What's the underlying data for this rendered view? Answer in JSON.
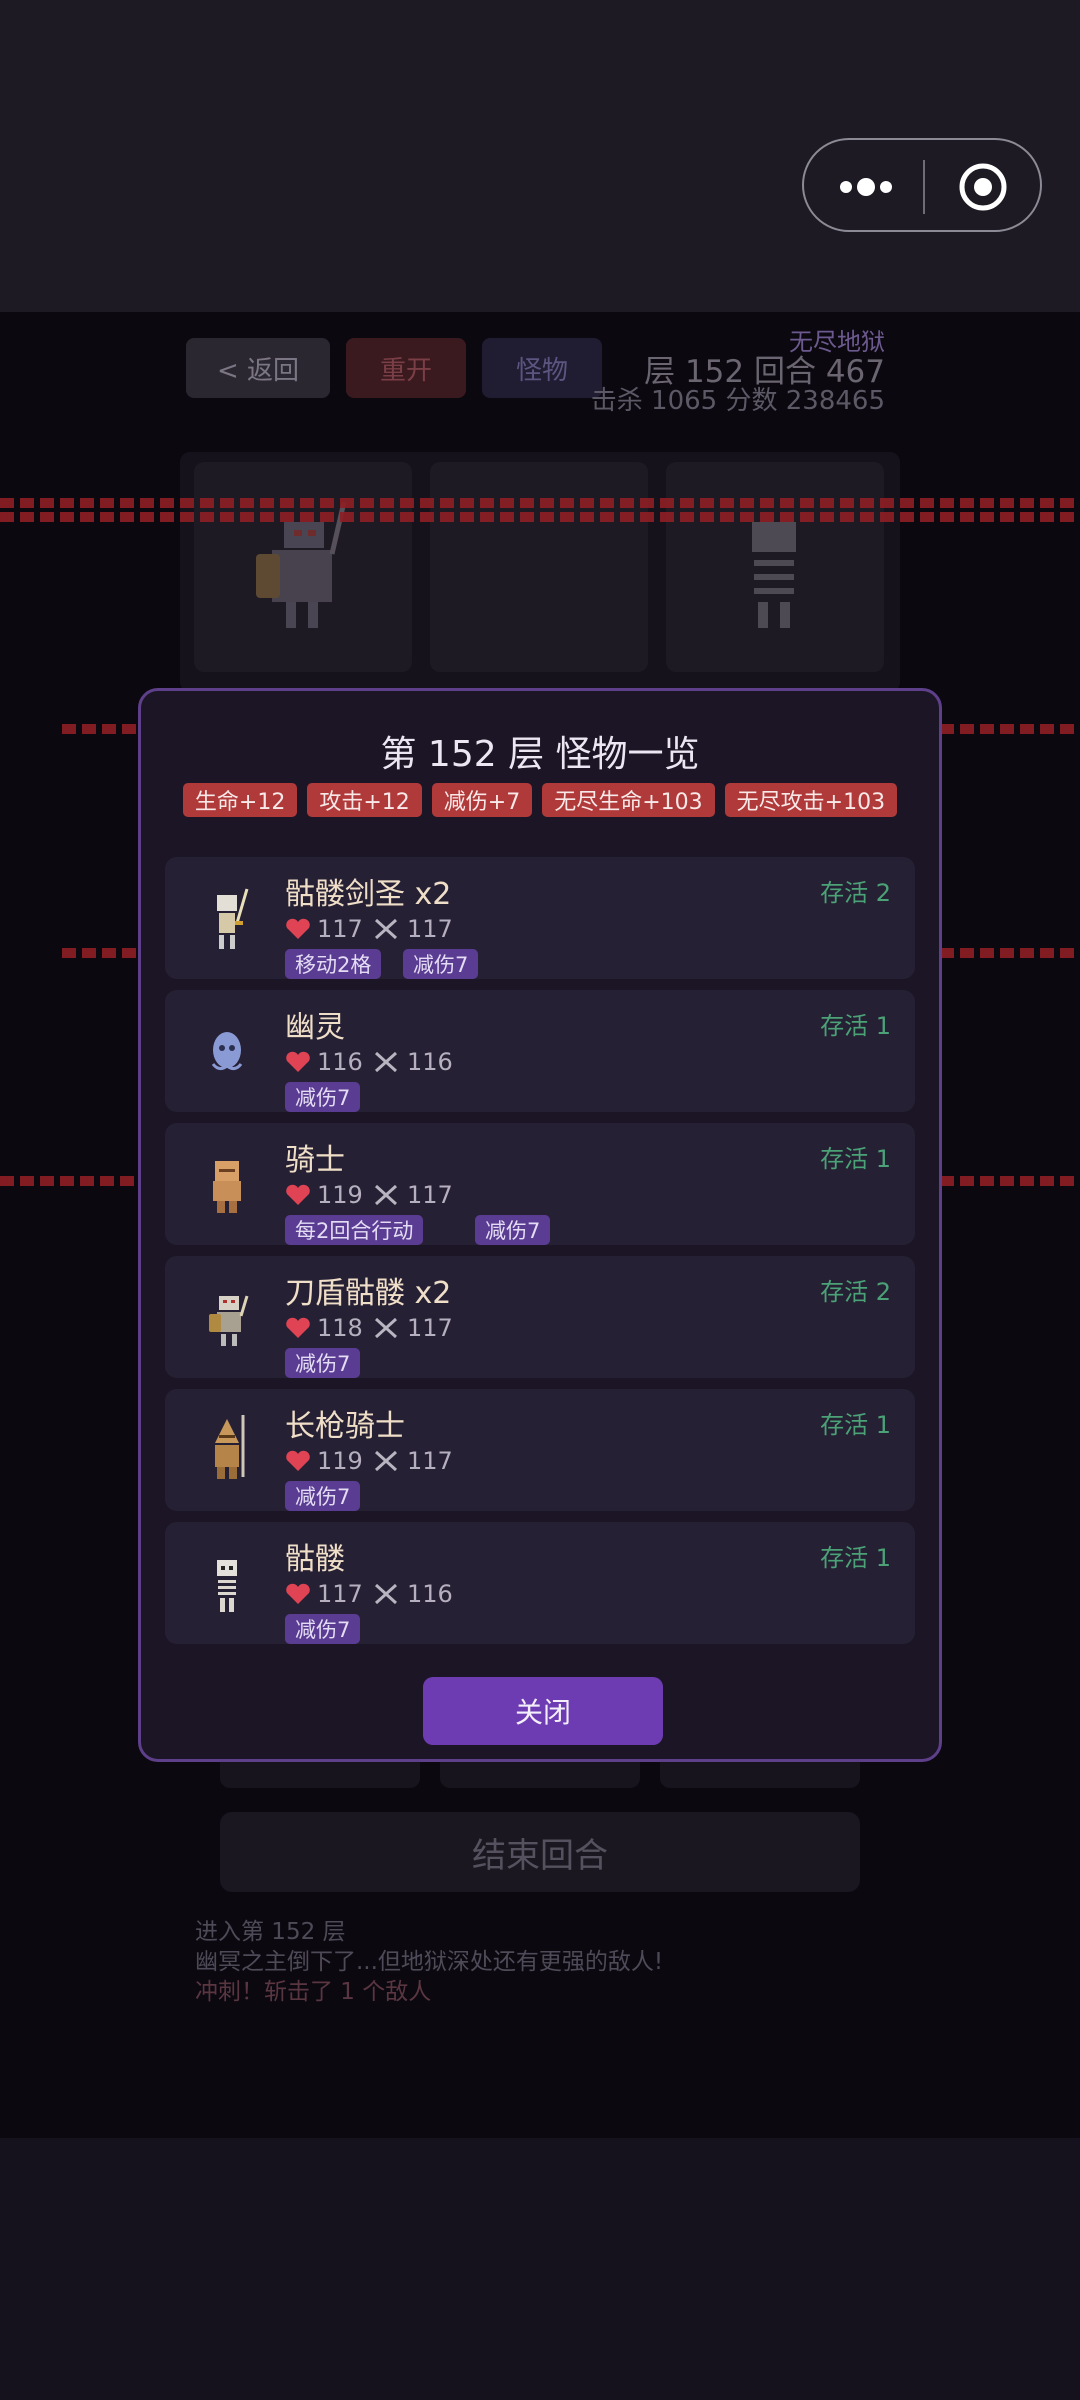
{
  "header": {
    "back": "< 返回",
    "restart": "重开",
    "monsters": "怪物",
    "mode": "无尽地狱",
    "floor_turn": "层 152  回合 467",
    "kills_score": "击杀 1065  分数 238465"
  },
  "modal": {
    "title": "第 152 层 怪物一览",
    "buffs": [
      "生命+12",
      "攻击+12",
      "减伤+7",
      "无尽生命+103",
      "无尽攻击+103"
    ],
    "monsters": [
      {
        "name": "骷髅剑圣 x2",
        "hp": "117",
        "atk": "117",
        "alive": "存活 2",
        "traits": [
          "移动2格",
          "减伤7"
        ],
        "icon": "skeleton-swordsaint-icon"
      },
      {
        "name": "幽灵",
        "hp": "116",
        "atk": "116",
        "alive": "存活 1",
        "traits": [
          "减伤7"
        ],
        "icon": "ghost-icon"
      },
      {
        "name": "骑士",
        "hp": "119",
        "atk": "117",
        "alive": "存活 1",
        "traits": [
          "每2回合行动",
          "减伤7"
        ],
        "icon": "knight-icon"
      },
      {
        "name": "刀盾骷髅 x2",
        "hp": "118",
        "atk": "117",
        "alive": "存活 2",
        "traits": [
          "减伤7"
        ],
        "icon": "shield-skeleton-icon"
      },
      {
        "name": "长枪骑士",
        "hp": "119",
        "atk": "117",
        "alive": "存活 1",
        "traits": [
          "减伤7"
        ],
        "icon": "lancer-icon"
      },
      {
        "name": "骷髅",
        "hp": "117",
        "atk": "116",
        "alive": "存活 1",
        "traits": [
          "减伤7"
        ],
        "icon": "skeleton-icon"
      }
    ],
    "close": "关闭"
  },
  "footer": {
    "end_turn": "结束回合",
    "log": [
      "进入第 152 层",
      "幽冥之主倒下了...但地狱深处还有更强的敌人!",
      "冲刺！斩击了 1 个敌人"
    ]
  },
  "colors": {
    "accent": "#6e3cb2",
    "buff": "#b03a3a",
    "trait": "#5a3d92",
    "alive": "#4ba277"
  }
}
